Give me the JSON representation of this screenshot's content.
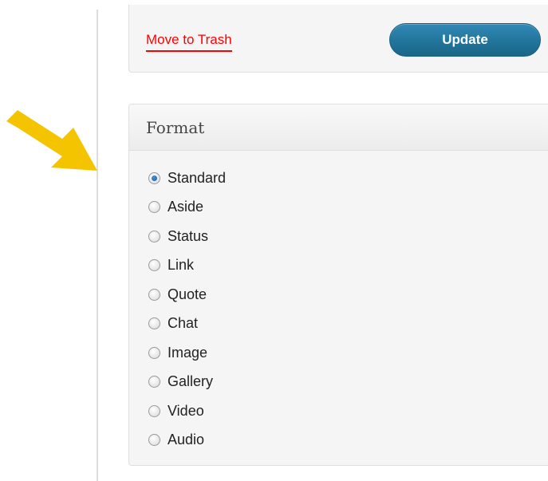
{
  "publish": {
    "trash_label": "Move to Trash",
    "update_label": "Update"
  },
  "format": {
    "title": "Format",
    "selected": "Standard",
    "options": [
      "Standard",
      "Aside",
      "Status",
      "Link",
      "Quote",
      "Chat",
      "Image",
      "Gallery",
      "Video",
      "Audio"
    ]
  },
  "colors": {
    "trash_link": "#ff0000",
    "update_button": "#21759b",
    "callout_arrow": "#f5c400"
  }
}
